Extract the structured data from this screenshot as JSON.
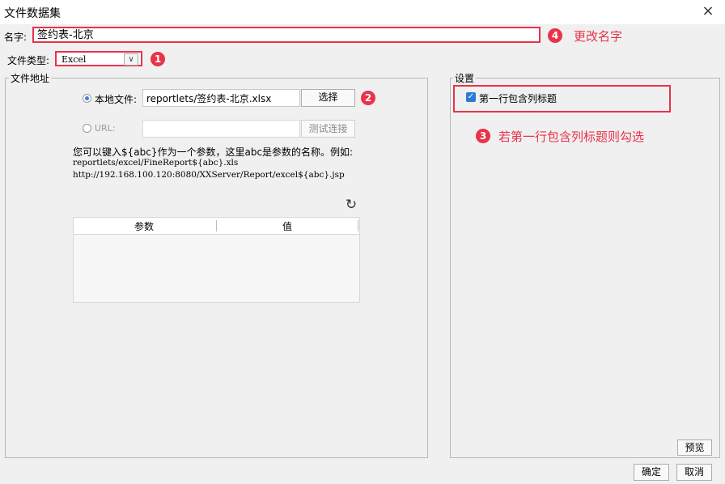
{
  "window": {
    "title": "文件数据集",
    "close_icon": "×"
  },
  "name_field": {
    "label": "名字:",
    "value": "签约表-北京"
  },
  "file_type": {
    "label": "文件类型:",
    "selected": "Excel",
    "chevron": "∨"
  },
  "file_address": {
    "group_title": "文件地址",
    "local_radio_label": "本地文件:",
    "local_path": "reportlets/签约表-北京.xlsx",
    "choose_button": "选择",
    "url_radio_label": "URL:",
    "url_value": "",
    "test_connection_button": "测试连接",
    "help_line1": "您可以键入${abc}作为一个参数，这里abc是参数的名称。例如:",
    "help_line2": "reportlets/excel/FineReport${abc}.xls",
    "help_line3": "http://192.168.100.120:8080/XXServer/Report/excel${abc}.jsp",
    "refresh_icon": "↻",
    "params_table": {
      "columns": [
        "参数",
        "值"
      ],
      "rows": []
    }
  },
  "settings": {
    "group_title": "设置",
    "first_row_header_label": "第一行包含列标题",
    "first_row_header_checked": true,
    "preview_button": "预览"
  },
  "annotations": {
    "badge1": "1",
    "badge2": "2",
    "badge3": "3",
    "badge4": "4",
    "note3": "若第一行包含列标题则勾选",
    "note4": "更改名字"
  },
  "footer": {
    "ok_button": "确定",
    "cancel_button": "取消"
  },
  "colors": {
    "annotation_red": "#e8334a",
    "checkbox_blue": "#2d7ad6"
  }
}
